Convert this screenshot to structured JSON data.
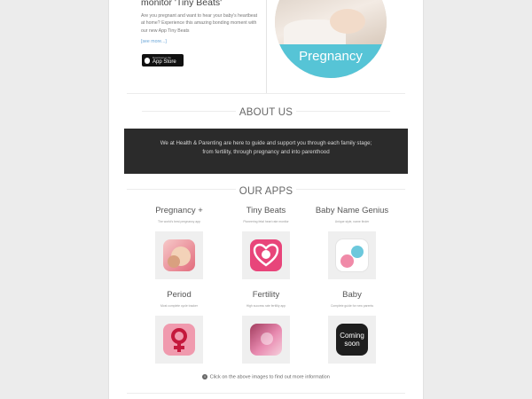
{
  "hero": {
    "title": "monitor 'Tiny Beats'",
    "text": "Are you pregnant and want to hear your baby's heartbeat at home? Experience this amazing bonding moment with our new App Tiny Beats",
    "more_link": "[see more...]",
    "appstore_small": "Download on the",
    "appstore_big": "App Store",
    "image_label": "Pregnancy"
  },
  "about": {
    "heading": "ABOUT US",
    "text": "We at Health & Parenting are here to guide and support you through each family stage; from fertility, through pregnancy and into parenthood"
  },
  "apps": {
    "heading": "OUR APPS",
    "items": [
      {
        "name": "Pregnancy +",
        "sub": "The world's best pregnancy app",
        "icon": "pregnancy-app-icon"
      },
      {
        "name": "Tiny Beats",
        "sub": "Pioneering fetal heart rate monitor",
        "icon": "tiny-beats-app-icon"
      },
      {
        "name": "Baby Name Genius",
        "sub": "Unique style, name finder",
        "icon": "baby-name-genius-app-icon"
      },
      {
        "name": "Period",
        "sub": "Most complete cycle tracker",
        "icon": "period-app-icon"
      },
      {
        "name": "Fertility",
        "sub": "High success rate fertility app",
        "icon": "fertility-app-icon"
      },
      {
        "name": "Baby",
        "sub": "Complete guide for new parents",
        "icon": "baby-app-icon",
        "coming_soon": "Coming soon"
      }
    ],
    "footer_note": "Click on the above images to find out more information"
  },
  "colors": {
    "accent": "#56c4d6",
    "dark_box": "#2b2b2b",
    "pink": "#e8457a"
  }
}
